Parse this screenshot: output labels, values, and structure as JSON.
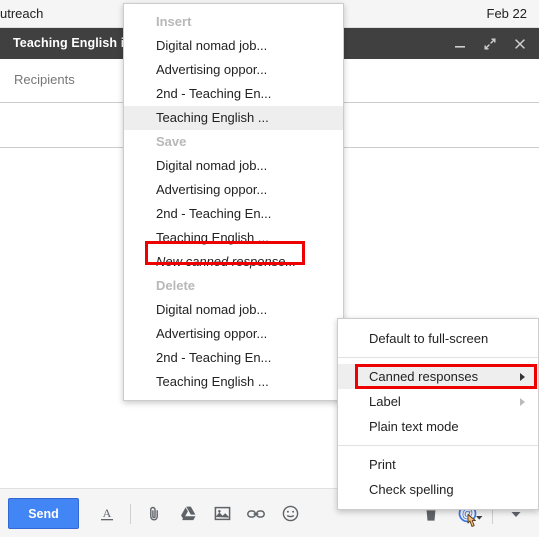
{
  "background_list": {
    "label": "utreach",
    "date": "Feb 22"
  },
  "compose": {
    "title": "Teaching English in",
    "recipients_placeholder": "Recipients",
    "subject_value": "",
    "body_value": "",
    "window_buttons": [
      {
        "name": "minimize-button",
        "icon": "minimize-icon"
      },
      {
        "name": "fullscreen-button",
        "icon": "expand-arrows-icon"
      },
      {
        "name": "close-button",
        "icon": "close-icon"
      }
    ]
  },
  "toolbar": {
    "send_label": "Send",
    "icons_left": [
      {
        "name": "formatting-options-button",
        "icon": "underlined-a-icon"
      },
      {
        "name": "attach-files-button",
        "icon": "paperclip-icon"
      },
      {
        "name": "insert-drive-button",
        "icon": "google-drive-icon"
      },
      {
        "name": "insert-photo-button",
        "icon": "image-icon"
      },
      {
        "name": "insert-link-button",
        "icon": "link-icon"
      },
      {
        "name": "insert-emoji-button",
        "icon": "smiley-icon"
      }
    ],
    "icons_right": [
      {
        "name": "discard-draft-button",
        "icon": "trash-icon"
      },
      {
        "name": "more-options-at-button",
        "icon": "at-sign-icon"
      },
      {
        "name": "more-options-button",
        "icon": "caret-down-icon"
      }
    ]
  },
  "canned_responses_menu": {
    "groups": [
      {
        "header": "Insert",
        "items": [
          {
            "label": "Digital nomad job...",
            "highlighted": false
          },
          {
            "label": "Advertising oppor...",
            "highlighted": false
          },
          {
            "label": "2nd - Teaching En...",
            "highlighted": false
          },
          {
            "label": "Teaching English ...",
            "highlighted": true
          }
        ]
      },
      {
        "header": "Save",
        "items": [
          {
            "label": "Digital nomad job...",
            "highlighted": false
          },
          {
            "label": "Advertising oppor...",
            "highlighted": false
          },
          {
            "label": "2nd - Teaching En...",
            "highlighted": false
          },
          {
            "label": "Teaching English ...",
            "highlighted": false
          },
          {
            "label": "New canned response...",
            "highlighted": false,
            "italic": true,
            "annotated": true
          }
        ]
      },
      {
        "header": "Delete",
        "items": [
          {
            "label": "Digital nomad job...",
            "highlighted": false
          },
          {
            "label": "Advertising oppor...",
            "highlighted": false
          },
          {
            "label": "2nd - Teaching En...",
            "highlighted": false
          },
          {
            "label": "Teaching English ...",
            "highlighted": false
          }
        ]
      }
    ]
  },
  "more_options_menu": {
    "items": [
      {
        "label": "Default to full-screen",
        "submenu": false,
        "highlighted": false
      },
      {
        "separator": true
      },
      {
        "label": "Canned responses",
        "submenu": true,
        "highlighted": true,
        "annotated": true
      },
      {
        "label": "Label",
        "submenu": true,
        "submenu_dim": true,
        "highlighted": false
      },
      {
        "label": "Plain text mode",
        "submenu": false,
        "highlighted": false
      },
      {
        "separator": true
      },
      {
        "label": "Print",
        "submenu": false,
        "highlighted": false
      },
      {
        "label": "Check spelling",
        "submenu": false,
        "highlighted": false
      }
    ]
  },
  "colors": {
    "send_blue": "#4285f4",
    "header_dark": "#404040",
    "annotation_red": "#ee0000",
    "menu_highlight": "#eeeeee"
  }
}
